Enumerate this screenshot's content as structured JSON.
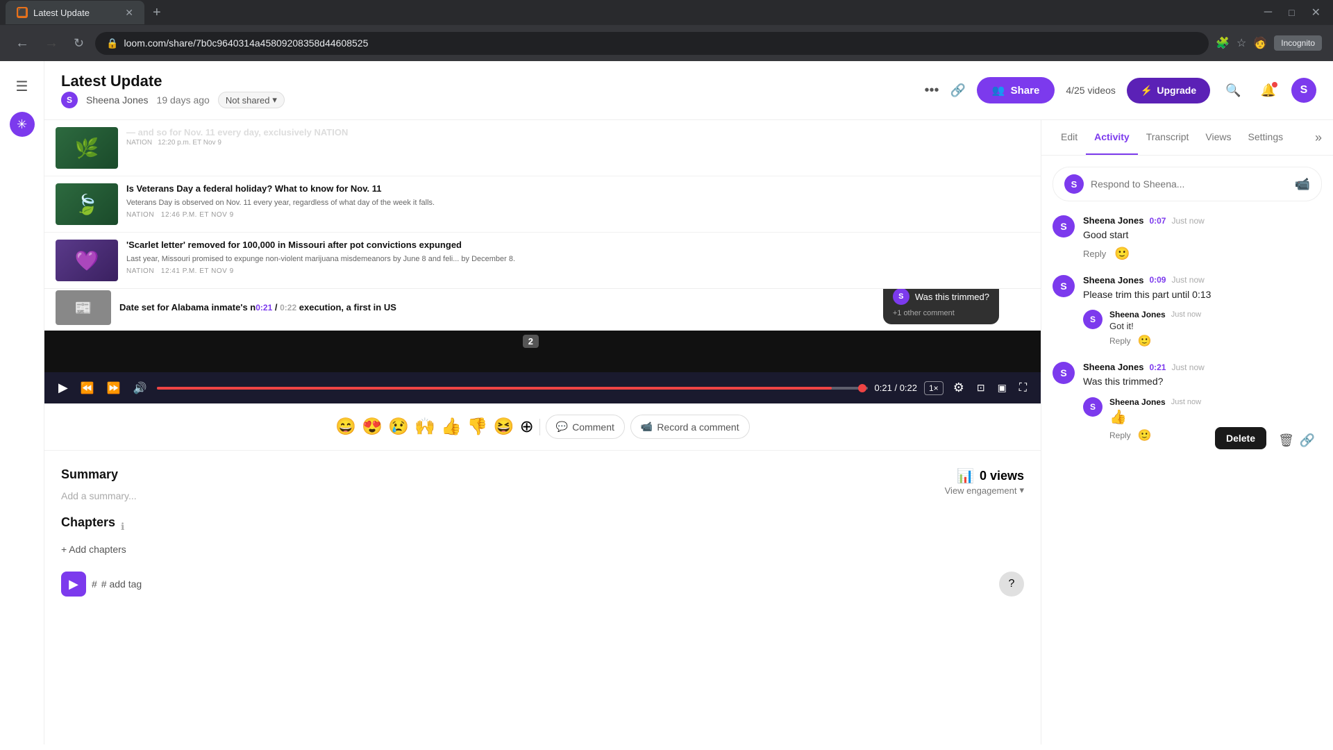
{
  "browser": {
    "tab_title": "Latest Update",
    "tab_favicon": "L",
    "url": "loom.com/share/7b0c9640314a45809208358d44608525",
    "incognito_label": "Incognito"
  },
  "header": {
    "title": "Latest Update",
    "author": "Sheena Jones",
    "time_ago": "19 days ago",
    "not_shared": "Not shared",
    "more_label": "•••",
    "share_label": "Share",
    "videos_count": "4/25 videos",
    "upgrade_label": "Upgrade",
    "avatar_initials": "S"
  },
  "video": {
    "comment_bubble_text": "Was this trimmed?",
    "comment_bubble_sub": "+1 other comment",
    "comment_badge": "2",
    "time_current": "0:21",
    "time_total": "0:22",
    "speed": "1×"
  },
  "news_items": [
    {
      "title": "Is Veterans Day a federal holiday? What to know for Nov. 11",
      "body": "Veterans Day is observed on Nov. 11 every year, regardless of what day of the week it falls.",
      "source": "NATION",
      "time": "12:46 p.m. ET Nov 9",
      "thumb_color": "#4a7c59"
    },
    {
      "title": "'Scarlet letter' removed for 100,000 in Missouri after pot convictions expunged",
      "body": "Last year, Missouri promised to expunge non-violent marijuana misdemeanors by June 8 and feli...  by December 8.",
      "source": "NATION",
      "time": "12:41 p.m. ET Nov 9",
      "thumb_color": "#6b9e3a"
    },
    {
      "title": "Date set for Alabama inmate's n0:21 / 0:22 execution, a first in US",
      "body": "",
      "source": "",
      "time": "",
      "thumb_color": "#888"
    }
  ],
  "emoji_bar": {
    "emojis": [
      "😄",
      "😍",
      "😢",
      "🙌",
      "👍",
      "👎",
      "😆"
    ],
    "comment_label": "Comment",
    "record_label": "Record a comment"
  },
  "summary": {
    "title": "Summary",
    "add_summary_placeholder": "Add a summary...",
    "chapters_title": "Chapters",
    "add_chapters_label": "+ Add chapters",
    "views_count": "0 views",
    "view_engagement": "View engagement"
  },
  "tag": {
    "placeholder": "# add tag"
  },
  "panel": {
    "tabs": [
      "Edit",
      "Activity",
      "Transcript",
      "Views",
      "Settings"
    ],
    "active_tab": "Activity",
    "respond_placeholder": "Respond to Sheena...",
    "comments": [
      {
        "author": "Sheena Jones",
        "time_code": "0:07",
        "timestamp": "Just now",
        "text": "Good start",
        "replies": []
      },
      {
        "author": "Sheena Jones",
        "time_code": "0:09",
        "timestamp": "Just now",
        "text": "Please trim this part until 0:13",
        "replies": [
          {
            "author": "Sheena Jones",
            "timestamp": "Just now",
            "text": "Got it!"
          }
        ]
      },
      {
        "author": "Sheena Jones",
        "time_code": "0:21",
        "timestamp": "Just now",
        "text": "Was this trimmed?",
        "replies": [
          {
            "author": "Sheena Jones",
            "timestamp": "Just now",
            "text": "👍"
          }
        ]
      }
    ],
    "delete_label": "Delete"
  }
}
